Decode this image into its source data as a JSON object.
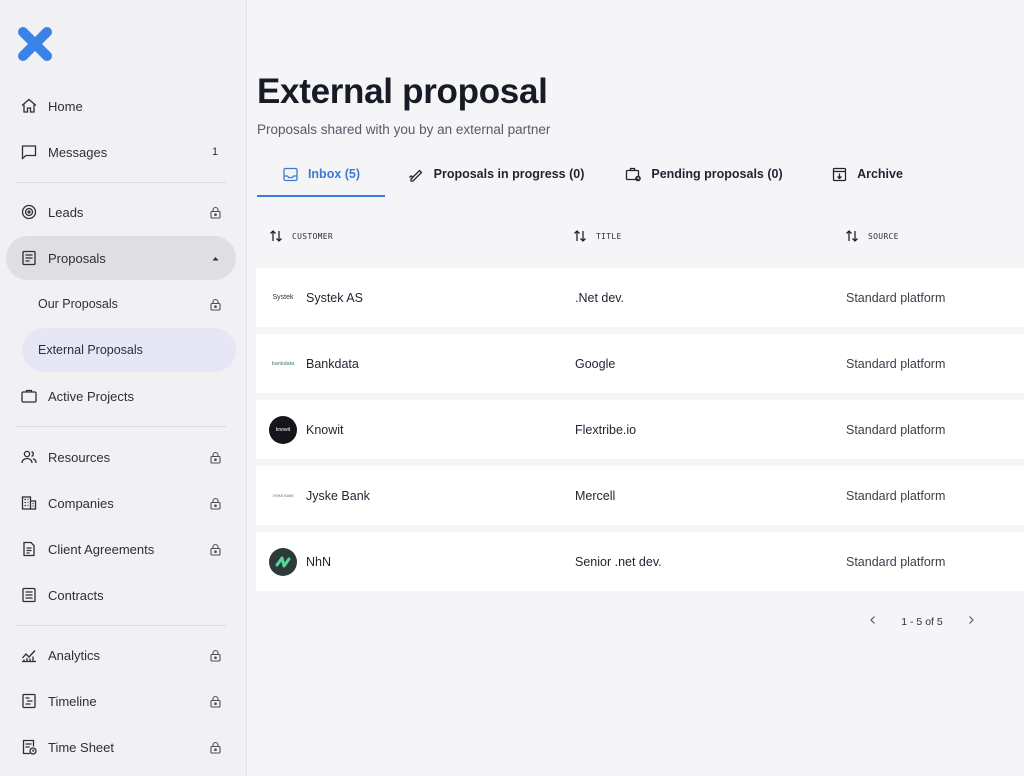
{
  "colors": {
    "accent": "#3a7bd5",
    "logo": "#3b82e6",
    "sidebar_bg": "#f1f1f4",
    "selected_bg": "#e6e6f7"
  },
  "sidebar": {
    "items": [
      {
        "label": "Home",
        "icon": "home-icon"
      },
      {
        "label": "Messages",
        "icon": "message-icon",
        "count": "1"
      },
      {
        "label": "Leads",
        "icon": "target-icon",
        "locked": true
      },
      {
        "label": "Proposals",
        "icon": "document-icon",
        "expanded": true
      },
      {
        "label": "Active Projects",
        "icon": "briefcase-icon"
      },
      {
        "label": "Resources",
        "icon": "people-icon",
        "locked": true
      },
      {
        "label": "Companies",
        "icon": "building-icon",
        "locked": true
      },
      {
        "label": "Client Agreements",
        "icon": "file-icon",
        "locked": true
      },
      {
        "label": "Contracts",
        "icon": "list-doc-icon"
      },
      {
        "label": "Analytics",
        "icon": "chart-icon",
        "locked": true
      },
      {
        "label": "Timeline",
        "icon": "timeline-icon",
        "locked": true
      },
      {
        "label": "Time Sheet",
        "icon": "timesheet-icon",
        "locked": true
      }
    ],
    "sub_items": [
      {
        "label": "Our Proposals",
        "locked": true
      },
      {
        "label": "External Proposals",
        "selected": true
      }
    ]
  },
  "header": {
    "title": "External proposal",
    "subtitle": "Proposals shared with you by an external partner"
  },
  "tabs": [
    {
      "label": "Inbox (5)",
      "icon": "inbox-icon",
      "active": true
    },
    {
      "label": "Proposals in progress (0)",
      "icon": "pen-icon"
    },
    {
      "label": "Pending proposals (0)",
      "icon": "pending-briefcase-icon"
    },
    {
      "label": "Archive",
      "icon": "archive-icon"
    }
  ],
  "table": {
    "columns": [
      "CUSTOMER",
      "TITLE",
      "SOURCE"
    ],
    "rows": [
      {
        "customer": "Systek AS",
        "logo_text": "Systek",
        "title": ".Net dev.",
        "source": "Standard platform"
      },
      {
        "customer": "Bankdata",
        "logo_text": "bankdata",
        "title": "Google",
        "source": "Standard platform"
      },
      {
        "customer": "Knowit",
        "logo_text": "knowit",
        "title": "Flextribe.io",
        "source": "Standard platform"
      },
      {
        "customer": "Jyske Bank",
        "logo_text": "JYSKE BANK",
        "title": "Mercell",
        "source": "Standard platform"
      },
      {
        "customer": "NhN",
        "logo_text": "",
        "title": "Senior .net dev.",
        "source": "Standard platform"
      }
    ]
  },
  "pagination": {
    "text": "1 - 5 of 5"
  }
}
